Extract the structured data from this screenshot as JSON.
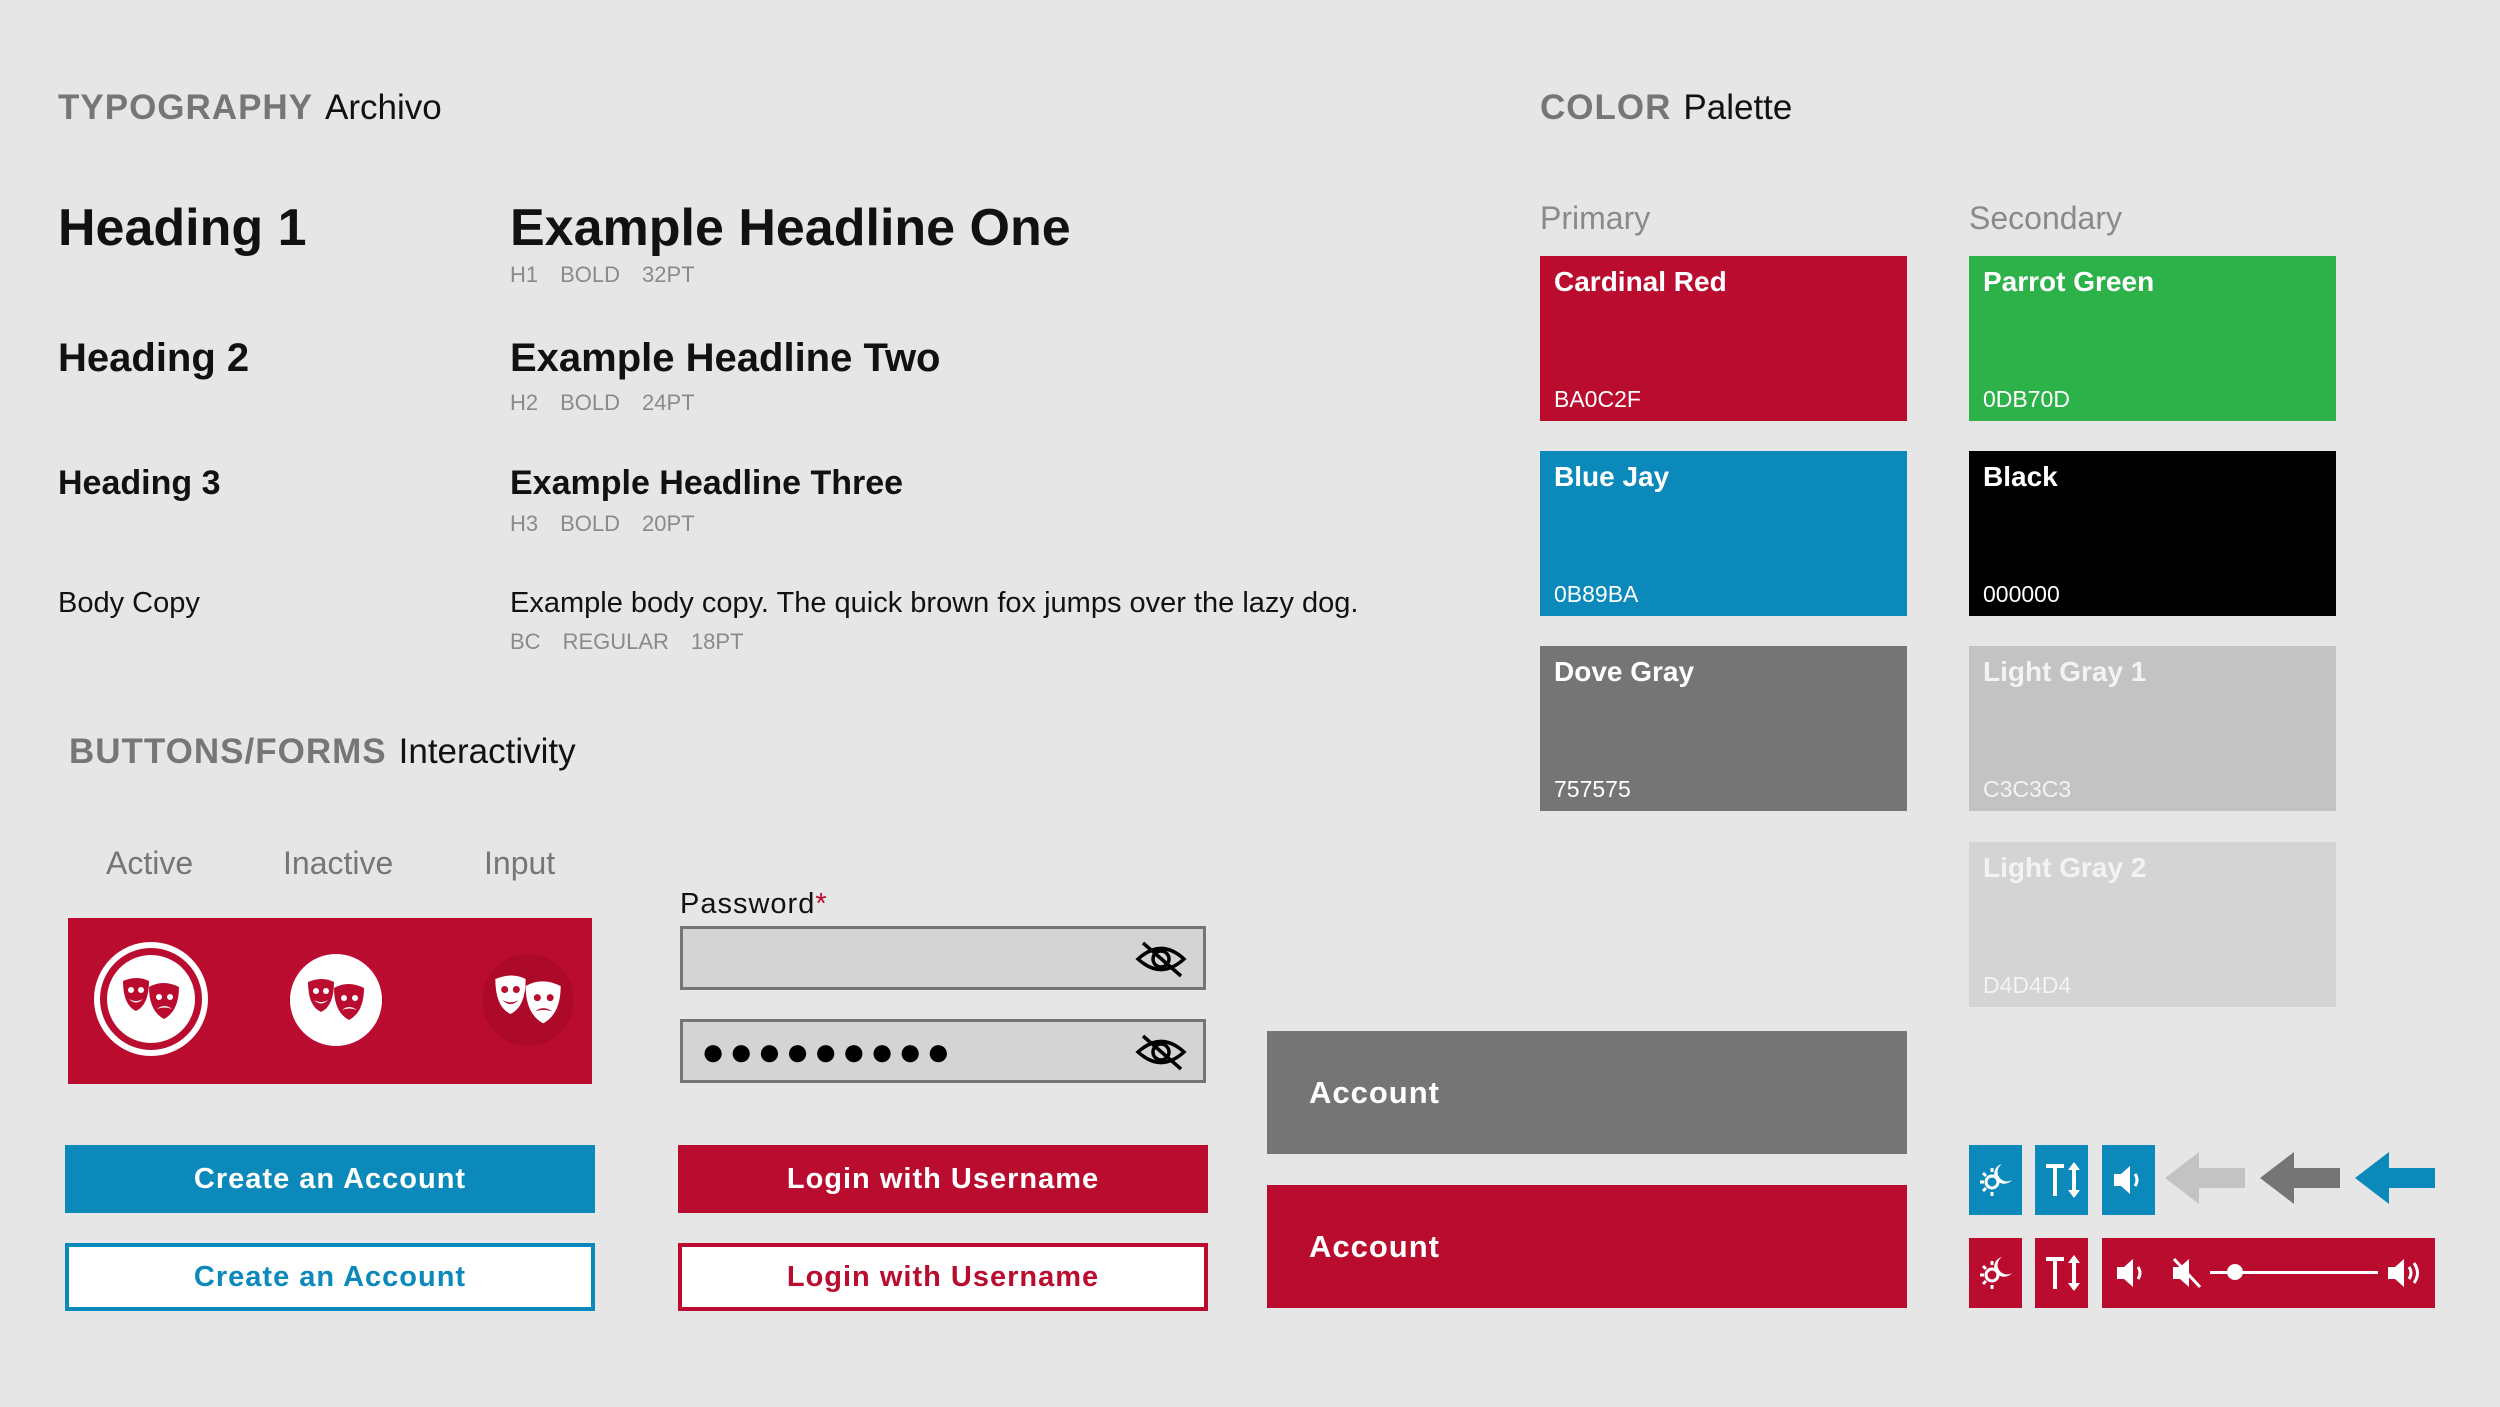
{
  "typography": {
    "section_key": "TYPOGRAPHY",
    "section_value": "Archivo",
    "rows": [
      {
        "label": "Heading 1",
        "example": "Example Headline One",
        "meta": [
          "H1",
          "BOLD",
          "32PT"
        ]
      },
      {
        "label": "Heading 2",
        "example": "Example Headline Two",
        "meta": [
          "H2",
          "BOLD",
          "24PT"
        ]
      },
      {
        "label": "Heading 3",
        "example": "Example Headline Three",
        "meta": [
          "H3",
          "BOLD",
          "20PT"
        ]
      },
      {
        "label": "Body Copy",
        "example": "Example body copy. The quick brown fox jumps over the lazy dog.",
        "meta": [
          "BC",
          "REGULAR",
          "18PT"
        ]
      }
    ]
  },
  "color": {
    "section_key": "COLOR",
    "section_value": "Palette",
    "primary_label": "Primary",
    "secondary_label": "Secondary",
    "primary": [
      {
        "name": "Cardinal Red",
        "hex": "BA0C2F",
        "color": "#ba0c2f"
      },
      {
        "name": "Blue Jay",
        "hex": "0B89BA",
        "color": "#0b89ba"
      },
      {
        "name": "Dove Gray",
        "hex": "757575",
        "color": "#757575"
      }
    ],
    "secondary": [
      {
        "name": "Parrot Green",
        "hex": "0DB70D",
        "color": "#2db24a"
      },
      {
        "name": "Black",
        "hex": "000000",
        "color": "#000000"
      },
      {
        "name": "Light Gray 1",
        "hex": "C3C3C3",
        "color": "#c3c3c3"
      },
      {
        "name": "Light Gray 2",
        "hex": "D4D4D4",
        "color": "#d4d4d4"
      }
    ]
  },
  "forms": {
    "section_key": "BUTTONS/FORMS",
    "section_value": "Interactivity",
    "states": [
      "Active",
      "Inactive",
      "Input"
    ],
    "password_label": "Password",
    "required_mark": "*",
    "password_value": "●●●●●●●●●",
    "buttons": {
      "create_filled": "Create an Account",
      "create_outline": "Create an Account",
      "login_filled": "Login with Username",
      "login_outline": "Login with Username",
      "account_gray": "Account",
      "account_red": "Account"
    },
    "icons": [
      "theme-toggle-icon",
      "text-size-icon",
      "speaker-icon",
      "arrow-left-light-icon",
      "arrow-left-dark-icon",
      "arrow-left-blue-icon",
      "mute-icon",
      "volume-slider",
      "volume-up-icon"
    ],
    "volume_level": 0.15
  }
}
